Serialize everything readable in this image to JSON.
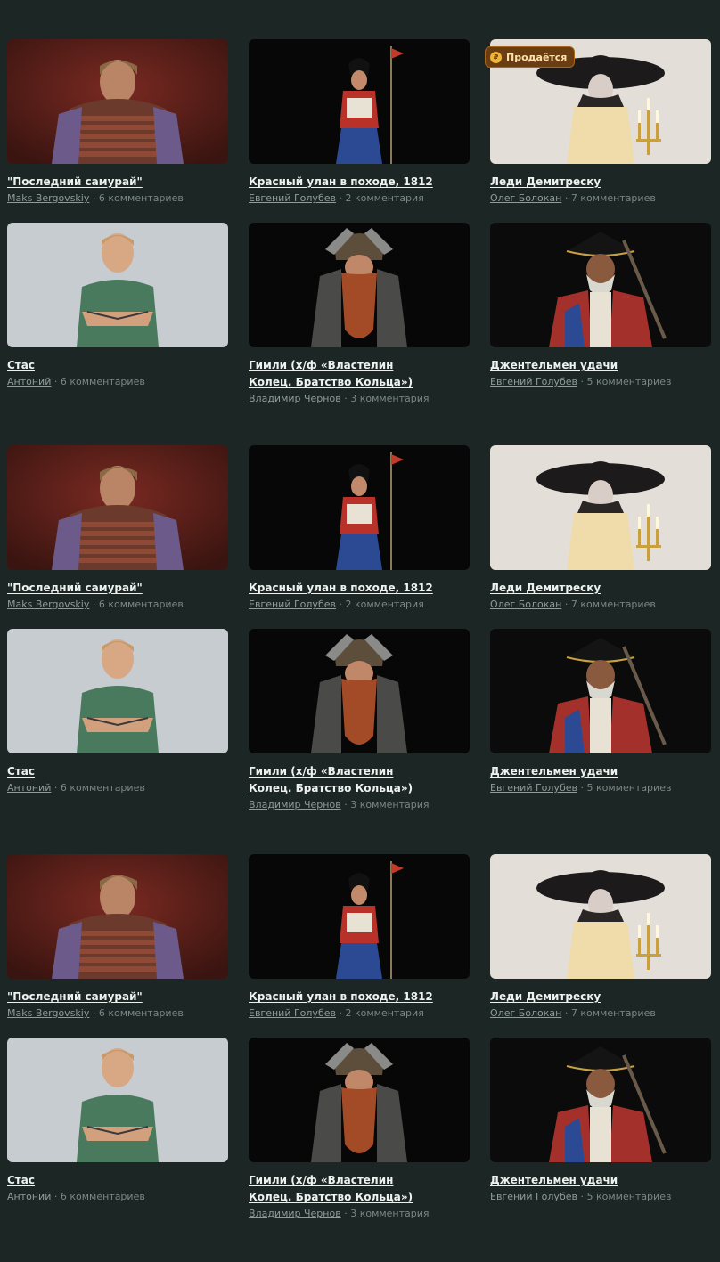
{
  "cards": [
    {
      "title": "\"Последний самурай\"",
      "author": "Maks Bergovskiy",
      "comments": "6 комментариев",
      "scene": "samurai"
    },
    {
      "title": "Красный улан в походе, 1812",
      "author": "Евгений Голубев",
      "comments": "2 комментария",
      "scene": "ulan"
    },
    {
      "title": "Леди Демитреску",
      "author": "Олег Болокан",
      "comments": "7 комментариев",
      "scene": "lady",
      "badge": "Продаётся"
    },
    {
      "title": "Стас",
      "author": "Антоний",
      "comments": "6 комментариев",
      "scene": "stas"
    },
    {
      "title": "Гимли (х/ф «Властелин Колец. Братство Кольца»)",
      "author": "Владимир Чернов",
      "comments": "3 комментария",
      "scene": "gimli"
    },
    {
      "title": "Джентельмен удачи",
      "author": "Евгений Голубев",
      "comments": "5 комментариев",
      "scene": "pirate"
    },
    {
      "title": "\"Последний самурай\"",
      "author": "Maks Bergovskiy",
      "comments": "6 комментариев",
      "scene": "samurai"
    },
    {
      "title": "Красный улан в походе, 1812",
      "author": "Евгений Голубев",
      "comments": "2 комментария",
      "scene": "ulan"
    },
    {
      "title": "Леди Демитреску",
      "author": "Олег Болокан",
      "comments": "7 комментариев",
      "scene": "lady"
    },
    {
      "title": "Стас",
      "author": "Антоний",
      "comments": "6 комментариев",
      "scene": "stas"
    },
    {
      "title": "Гимли (х/ф «Властелин Колец. Братство Кольца»)",
      "author": "Владимир Чернов",
      "comments": "3 комментария",
      "scene": "gimli"
    },
    {
      "title": "Джентельмен удачи",
      "author": "Евгений Голубев",
      "comments": "5 комментариев",
      "scene": "pirate"
    },
    {
      "title": "\"Последний самурай\"",
      "author": "Maks Bergovskiy",
      "comments": "6 комментариев",
      "scene": "samurai"
    },
    {
      "title": "Красный улан в походе, 1812",
      "author": "Евгений Голубев",
      "comments": "2 комментария",
      "scene": "ulan"
    },
    {
      "title": "Леди Демитреску",
      "author": "Олег Болокан",
      "comments": "7 комментариев",
      "scene": "lady"
    },
    {
      "title": "Стас",
      "author": "Антоний",
      "comments": "6 комментариев",
      "scene": "stas"
    },
    {
      "title": "Гимли (х/ф «Властелин Колец. Братство Кольца»)",
      "author": "Владимир Чернов",
      "comments": "3 комментария",
      "scene": "gimli"
    },
    {
      "title": "Джентельмен удачи",
      "author": "Евгений Голубев",
      "comments": "5 комментариев",
      "scene": "pirate"
    }
  ],
  "separator": " · ",
  "colors": {
    "background": "#1c2625",
    "title": "#eef2ef",
    "meta": "#7a8783",
    "badge": "#6a3d12"
  }
}
